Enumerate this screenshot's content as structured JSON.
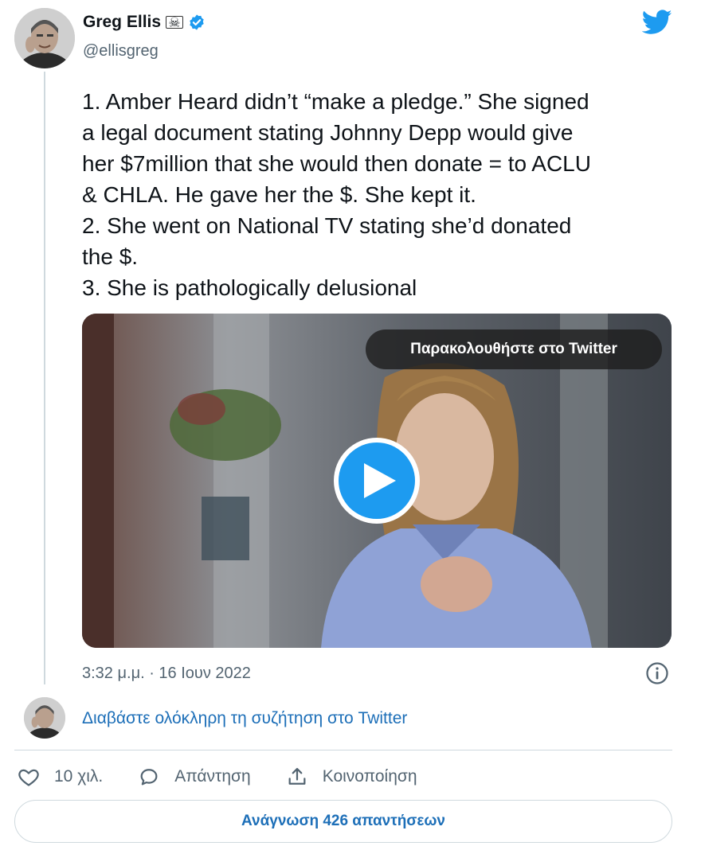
{
  "author": {
    "name": "Greg Ellis",
    "badge_emoji": "☠",
    "handle": "@ellisgreg",
    "verified": true
  },
  "tweet": {
    "lines": [
      "1. Amber Heard didn’t “make a pledge.” She signed",
      "a legal document stating Johnny Depp would give",
      "her $7million that she would then donate = to ACLU",
      "& CHLA. He gave her the $. She kept it.",
      "2. She went on National TV stating she’d donated",
      "the $.",
      "3. She is pathologically delusional"
    ],
    "timestamp": "3:32 μ.μ. · 16 Ιουν 2022"
  },
  "media": {
    "watch_label": "Παρακολουθήστε στο Twitter",
    "play_icon": "play-icon"
  },
  "footer": {
    "read_conversation": "Διαβάστε ολόκληρη τη συζήτηση στο Twitter",
    "likes": "10 χιλ.",
    "reply_label": "Απάντηση",
    "share_label": "Κοινοποίηση",
    "read_replies": "Ανάγνωση 426 απαντήσεων"
  },
  "colors": {
    "twitter_blue": "#1d9bf0",
    "link_blue": "#1d6fb8",
    "muted": "#536471",
    "border": "#cfd9de"
  }
}
